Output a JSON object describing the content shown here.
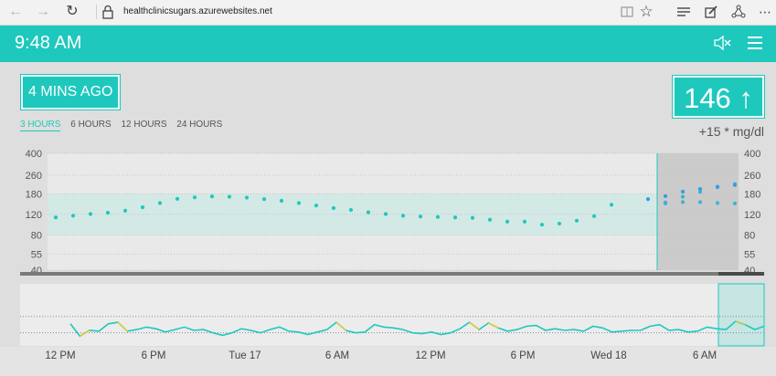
{
  "browser": {
    "url": "healthclinicsugars.azurewebsites.net",
    "icons": [
      "back-icon",
      "forward-icon",
      "refresh-icon",
      "lock-icon",
      "reading-view-icon",
      "favorite-star-icon",
      "hub-icon",
      "web-note-icon",
      "share-icon"
    ]
  },
  "header": {
    "time": "9:48 AM",
    "icons": [
      "mute-icon",
      "menu-icon"
    ]
  },
  "status": {
    "last_reading_ago": "4 MINS AGO",
    "current_bg": "146 ↑",
    "delta": "+15 * mg/dl"
  },
  "range_tabs": [
    "3 HOURS",
    "6 HOURS",
    "12 HOURS",
    "24 HOURS"
  ],
  "active_tab": "3 HOURS",
  "colors": {
    "accent": "#1ec8bd",
    "readings": "#1ec8bd",
    "predictions": "#3a9be0",
    "high_low": "#e6c93a"
  },
  "chart_data": [
    {
      "type": "scatter",
      "title": "",
      "y_ticks": [
        "400",
        "260",
        "180",
        "120",
        "80",
        "55",
        "40"
      ],
      "y_scale": "log",
      "target_range": [
        80,
        180
      ],
      "series": [
        {
          "values": [
            113,
            117,
            121,
            124,
            129,
            138,
            150,
            163,
            168,
            171,
            170,
            167,
            162,
            157,
            150,
            143,
            136,
            131,
            125,
            121,
            117,
            115,
            114,
            113,
            112,
            108,
            104,
            104,
            98,
            100,
            106,
            116,
            145
          ]
        },
        {
          "values": [
            152,
            149,
            170,
            153,
            187,
            153,
            205,
            150,
            218,
            149
          ]
        },
        {
          "values": [
            162,
            172,
            188,
            198,
            207,
            214
          ]
        }
      ],
      "now_marker": true
    },
    {
      "type": "line",
      "title": "",
      "x_labels": [
        "12 PM",
        "6 PM",
        "Tue 17",
        "6 AM",
        "12 PM",
        "6 PM",
        "Wed 18",
        "6 AM"
      ],
      "y_range": [
        0,
        380
      ],
      "thresholds": [
        180,
        80
      ],
      "series": [
        {
          "values": [
            135,
            60,
            95,
            90,
            135,
            145,
            90,
            100,
            115,
            105,
            85,
            100,
            115,
            95,
            100,
            80,
            65,
            80,
            105,
            95,
            80,
            100,
            115,
            90,
            85,
            70,
            85,
            100,
            145,
            95,
            80,
            85,
            130,
            115,
            110,
            100,
            80,
            75,
            85,
            70,
            80,
            105,
            145,
            100,
            140,
            110,
            90,
            100,
            120,
            125,
            95,
            105,
            95,
            100,
            90,
            120,
            110,
            85,
            90,
            95,
            95,
            120,
            130,
            95,
            100,
            85,
            90,
            115,
            105,
            100,
            150,
            130,
            100,
            120
          ]
        }
      ]
    }
  ]
}
